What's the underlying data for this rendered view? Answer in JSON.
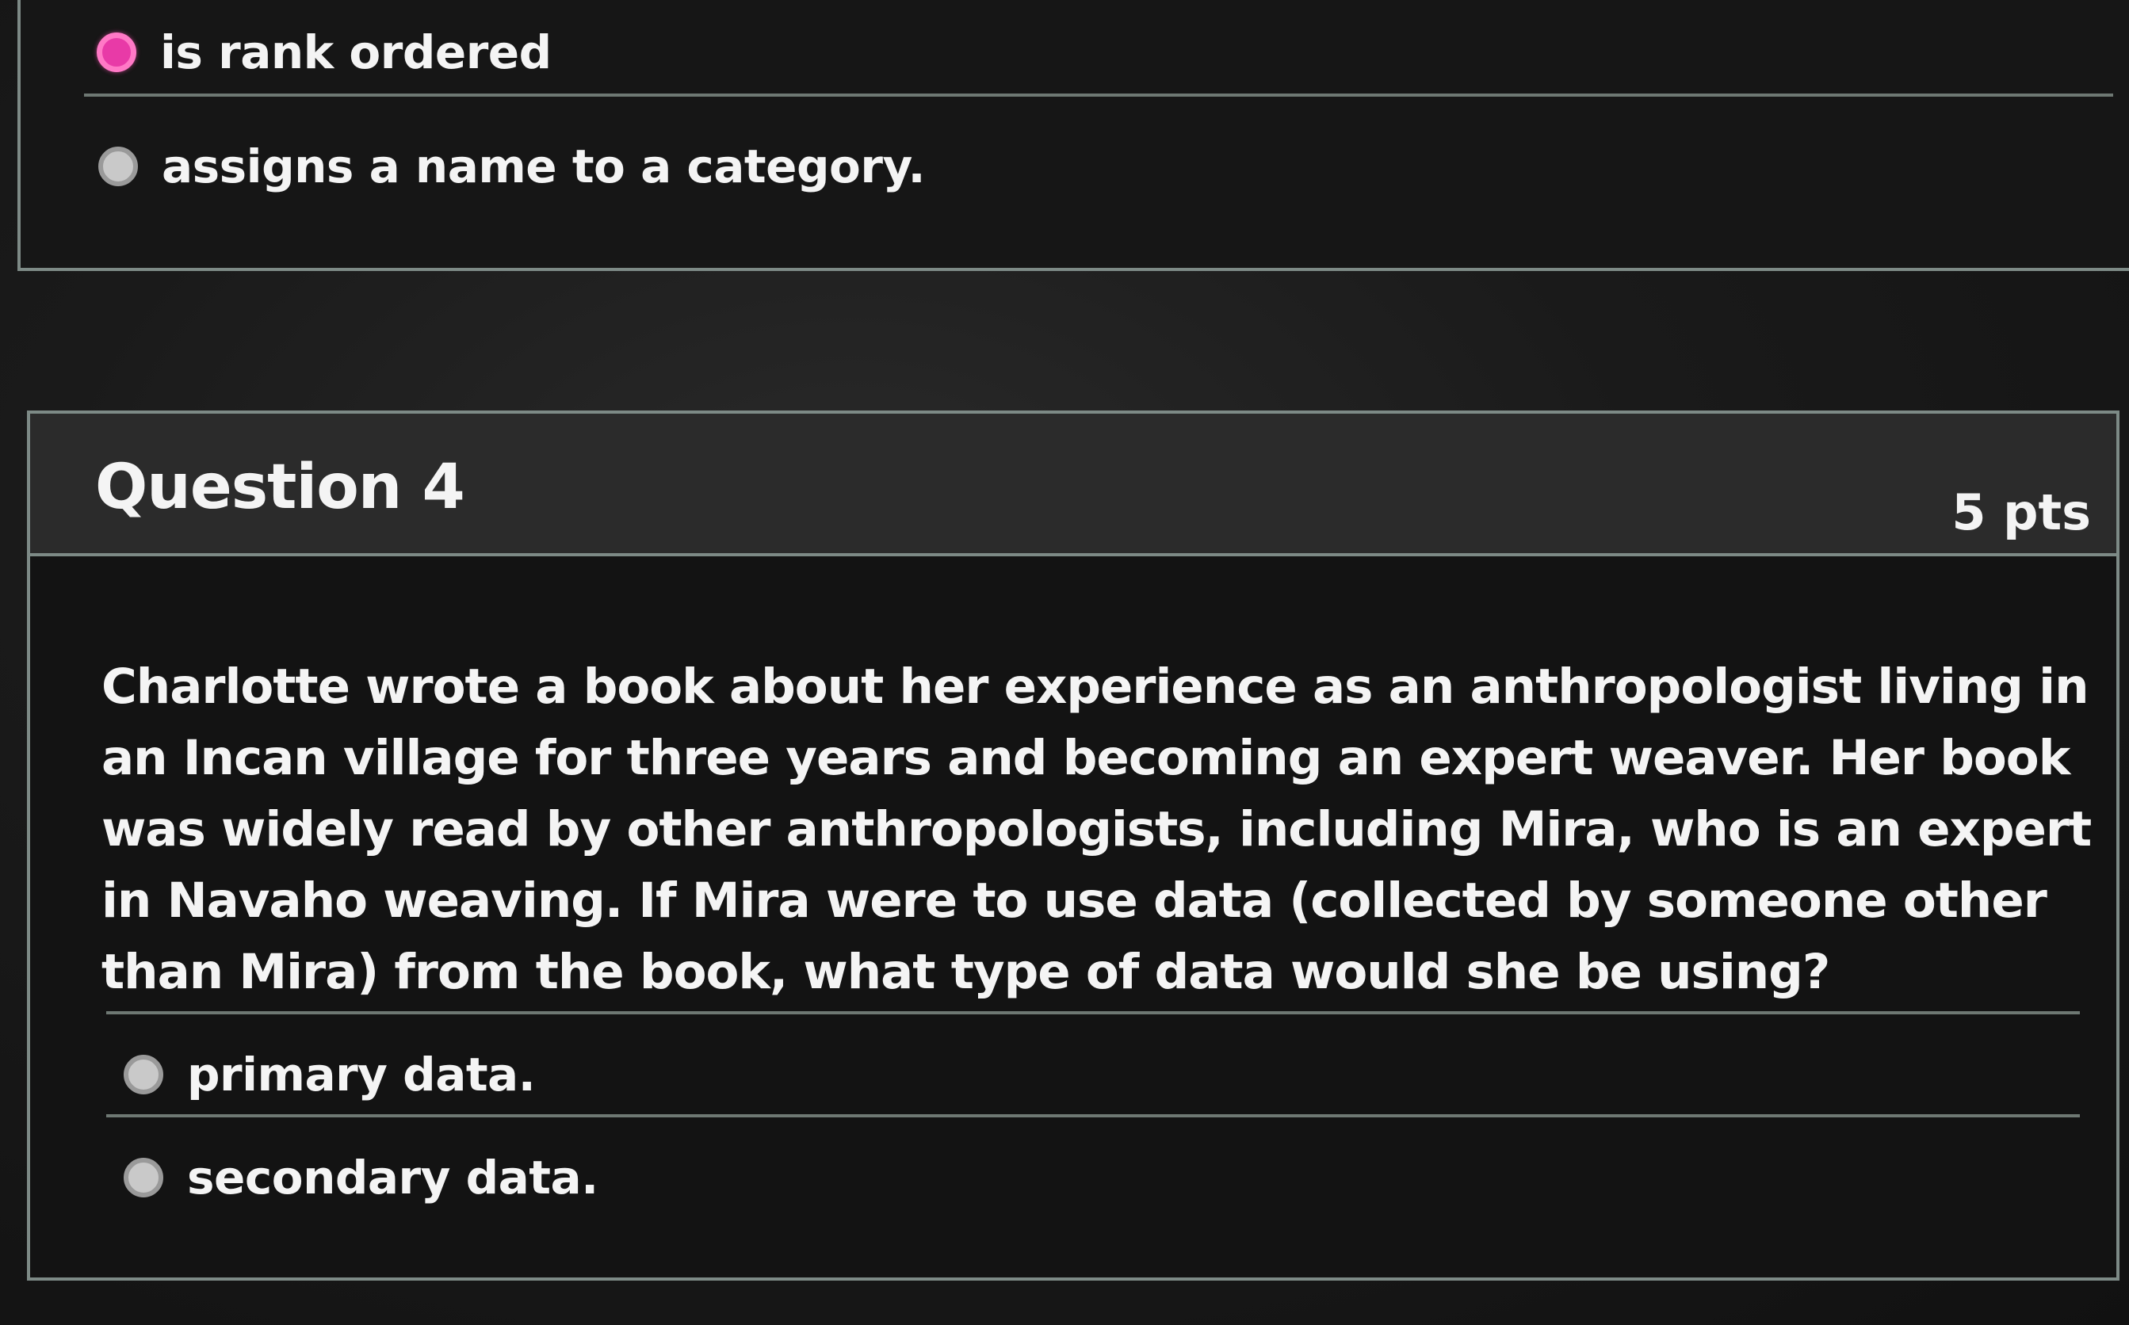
{
  "previous_question": {
    "answers": [
      {
        "label": "is rank ordered",
        "selected": true
      },
      {
        "label": "assigns a name to a category.",
        "selected": false
      }
    ]
  },
  "question": {
    "title": "Question 4",
    "points": "5 pts",
    "text": "Charlotte wrote a book about her experience as an anthropologist living in an Incan village for three years and becoming an expert weaver. Her book was widely read by other anthropologists, including Mira, who is an expert in Navaho weaving. If Mira were to use data (collected by someone other than Mira) from the book, what type of data would she be using?",
    "answers": [
      {
        "label": "primary data.",
        "selected": false
      },
      {
        "label": "secondary data.",
        "selected": false
      }
    ]
  },
  "colors": {
    "selected_radio": "#e83aa7",
    "card_border": "#7d8a86",
    "header_bg": "#2b2b2b"
  }
}
